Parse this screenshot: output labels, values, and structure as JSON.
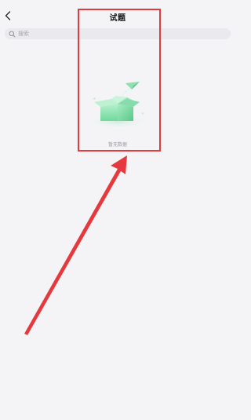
{
  "header": {
    "back_icon": "chevron-left-icon",
    "title": "试题"
  },
  "search": {
    "icon": "search-icon",
    "placeholder": "搜索"
  },
  "empty_state": {
    "illustration": "open-box-with-paper-plane-icon",
    "text": "暂无数据"
  },
  "annotation": {
    "highlight_color": "#e5393d",
    "arrow_color": "#e5393d"
  },
  "colors": {
    "background": "#f4f4f6",
    "accent_green": "#7ee0a6"
  }
}
